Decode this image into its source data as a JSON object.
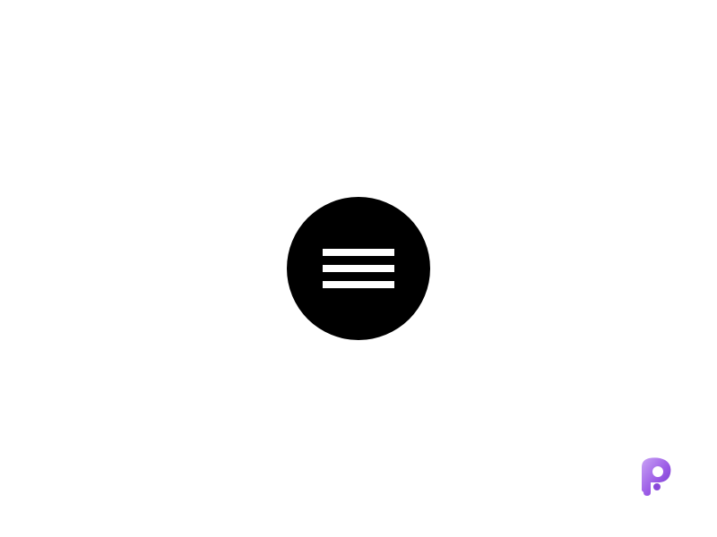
{
  "menu_button": {
    "icon": "hamburger-menu-icon",
    "background_color": "#000000",
    "bar_color": "#ffffff"
  },
  "logo": {
    "icon": "p-brand-logo",
    "color_light": "#b98cf0",
    "color_dark": "#7a3fd1"
  }
}
